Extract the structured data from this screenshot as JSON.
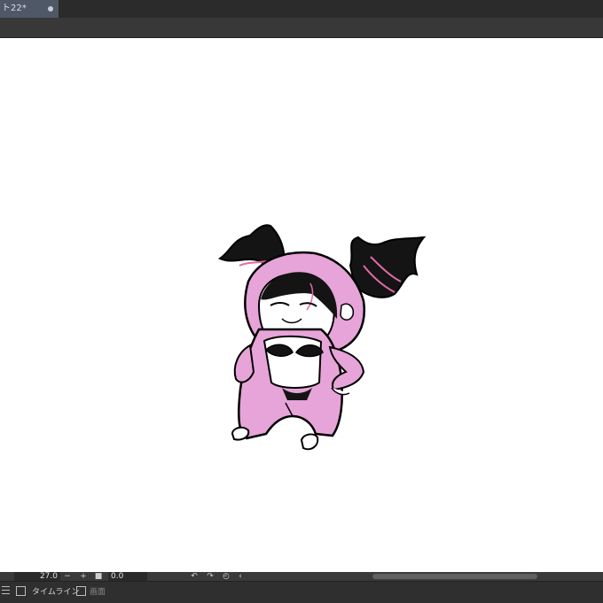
{
  "document_tab": {
    "title": "ト22*"
  },
  "frame_controls": {
    "frame_value": "27.0",
    "minus": "−",
    "plus": "+",
    "stop": "■",
    "time_value": "0.0",
    "undo_glyph": "↶",
    "redo_glyph": "↷",
    "reset_glyph": "◴",
    "back_glyph": "‹"
  },
  "bottom_panel": {
    "timeline_tab": "タイムライン",
    "second_tab": "画面"
  },
  "colors": {
    "hoodie_pink": "#e6a4d8",
    "hair_black": "#141414",
    "accent_pink": "#e36aa6",
    "tab_active": "#4f5867",
    "ui_dark": "#2b2b2b"
  }
}
